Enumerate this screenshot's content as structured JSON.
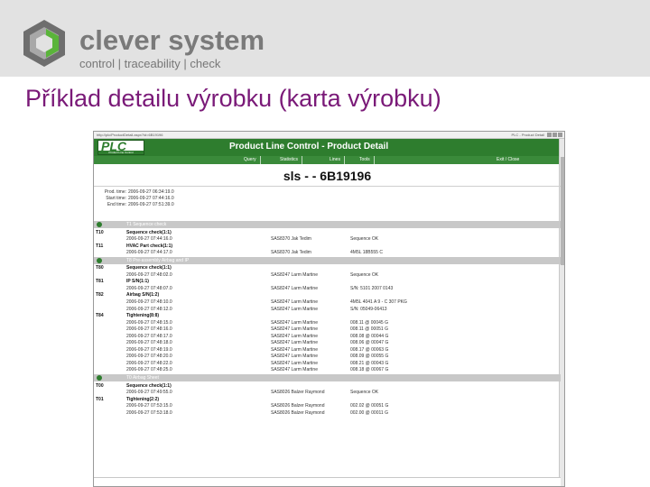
{
  "slide": {
    "brand_name": "clever system",
    "tagline": "control | traceability | check",
    "title": "Příklad detailu výrobku (karta výrobku)"
  },
  "browser": {
    "url": "http://plc/ProductDetail.aspx?id=6B19196",
    "tabs_right": "PLC - Product Detail",
    "app_logo": "PLC",
    "app_logo_sub": "Product Line Control",
    "app_title": "Product Line Control - Product Detail",
    "nav": [
      "Query",
      "Statistics",
      "Lines",
      "Tools",
      "Exit / Close"
    ],
    "product_code": "sls -  - 6B19196",
    "times": [
      {
        "label": "Prod. time:",
        "value": "2006-09-27 06:34:19.0"
      },
      {
        "label": "Start time:",
        "value": "2006-09-27 07:44:16.0"
      },
      {
        "label": "End time:",
        "value": "2006-09-27 07:51:39.0"
      }
    ],
    "sections": [
      {
        "label": "T1 Sequence check",
        "rows": [
          {
            "station": "T10",
            "name": "Sequence check(1:1)",
            "ts": "2006-09-27 07:44:16.0",
            "op": "SAS8370 Jak Tedim",
            "res": "Sequence OK"
          },
          {
            "station": "T11",
            "name": "HVAC Part check(1:1)",
            "ts": "2006-09-27 07:44:17.0",
            "op": "SAS8370 Jak Tedim",
            "res": "4M5L 18B555 C"
          }
        ]
      },
      {
        "label": "T8 Pre-assembly Airbag and IP",
        "rows": [
          {
            "station": "T80",
            "name": "Sequence check(1:1)",
            "ts": "2006-09-27 07:48:02.0",
            "op": "SAS8247 Larm Martine",
            "res": "Sequence OK"
          },
          {
            "station": "T81",
            "name": "IP S/N(1:1)",
            "ts": "2006-09-27 07:48:07.0",
            "op": "SAS8247 Larm Martine",
            "res": "S/N: 5101 2007 0143"
          },
          {
            "station": "T82",
            "name": "Airbag S/N(1:2)",
            "ts": "2006-09-27 07:48:10.0",
            "op": "SAS8247 Larm Martine",
            "res": "4M5L 4041 A 9 - C 307 PKG"
          },
          {
            "station": "",
            "name": "",
            "ts": "2006-09-27 07:48:12.0",
            "op": "SAS8247 Larm Martine",
            "res": "S/N: 05049-06413"
          },
          {
            "station": "T84",
            "name": "Tightening(8:8)",
            "ts": "",
            "op": "",
            "res": ""
          },
          {
            "station": "",
            "name": "",
            "ts": "2006-09-27 07:48:15.0",
            "op": "SAS8247 Larm Martine",
            "res": "008.11 @ 00045 G"
          },
          {
            "station": "",
            "name": "",
            "ts": "2006-09-27 07:48:16.0",
            "op": "SAS8247 Larm Martine",
            "res": "008.11 @ 00051 G"
          },
          {
            "station": "",
            "name": "",
            "ts": "2006-09-27 07:48:17.0",
            "op": "SAS8247 Larm Martine",
            "res": "008.08 @ 00044 G"
          },
          {
            "station": "",
            "name": "",
            "ts": "2006-09-27 07:48:18.0",
            "op": "SAS8247 Larm Martine",
            "res": "008.06 @ 00047 G"
          },
          {
            "station": "",
            "name": "",
            "ts": "2006-09-27 07:48:19.0",
            "op": "SAS8247 Larm Martine",
            "res": "008.17 @ 00063 G"
          },
          {
            "station": "",
            "name": "",
            "ts": "2006-09-27 07:48:20.0",
            "op": "SAS8247 Larm Martine",
            "res": "008.09 @ 00055 G"
          },
          {
            "station": "",
            "name": "",
            "ts": "2006-09-27 07:48:22.0",
            "op": "SAS8247 Larm Martine",
            "res": "008.21 @ 00043 G"
          },
          {
            "station": "",
            "name": "",
            "ts": "2006-09-27 07:48:25.0",
            "op": "SAS8247 Larm Martine",
            "res": "008.18 @ 00067 G"
          }
        ]
      },
      {
        "label": "T0 Airbag Sheet",
        "rows": [
          {
            "station": "T00",
            "name": "Sequence check(1:1)",
            "ts": "",
            "op": "",
            "res": ""
          },
          {
            "station": "",
            "name": "",
            "ts": "2006-09-27 07:49:55.0",
            "op": "SAS8026 Balzer Raymond",
            "res": "Sequence OK"
          },
          {
            "station": "T01",
            "name": "Tightening(2:2)",
            "ts": "",
            "op": "",
            "res": ""
          },
          {
            "station": "",
            "name": "",
            "ts": "2006-09-27 07:53:15.0",
            "op": "SAS8026 Balzer Raymond",
            "res": "002.02 @ 00051 G"
          },
          {
            "station": "",
            "name": "",
            "ts": "2006-09-27 07:53:18.0",
            "op": "SAS8026 Balzer Raymond",
            "res": "002.00 @ 00011 G"
          }
        ]
      }
    ]
  },
  "colors": {
    "title": "#7a1a78",
    "plc_green": "#2e7d2e",
    "header_band": "#e2e2e2"
  }
}
